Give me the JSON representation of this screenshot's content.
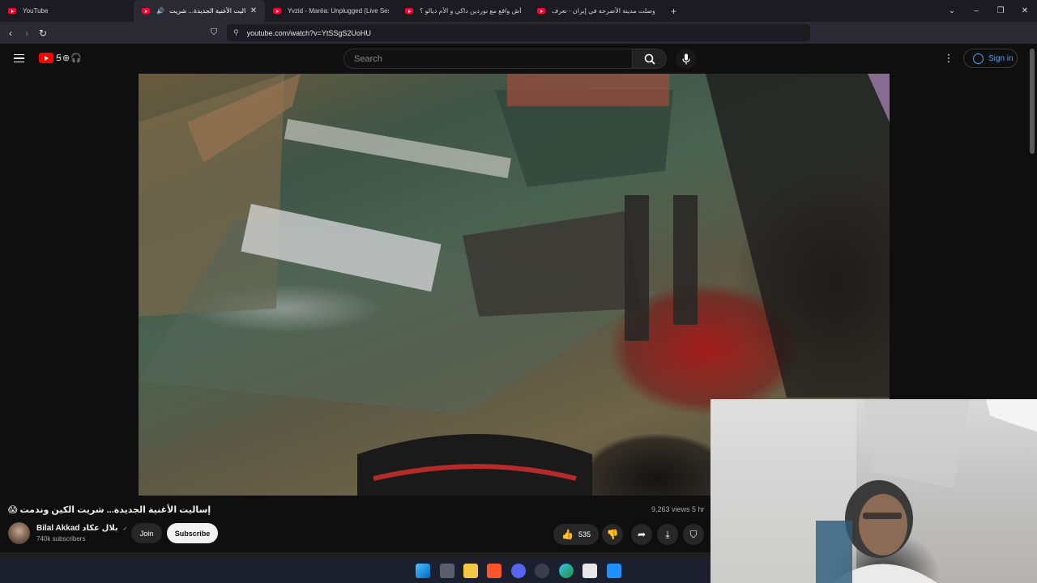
{
  "browser": {
    "tabs": [
      {
        "label": "YouTube"
      },
      {
        "label": "إساليت الأغنية الجديدة... شريت",
        "active": true
      },
      {
        "label": "Yvzid - Maréa: Unplugged (Live Sess"
      },
      {
        "label": "أش واقع مع نوردين داكي و الأم ديالو ؟"
      },
      {
        "label": "وصلت مدينة الأضرحة في إيران - تعرف..."
      }
    ],
    "new_tab": "+",
    "url": "youtube.com/watch?v=YtSSgS2UoHU",
    "window_controls": [
      "⌄",
      "–",
      "❐",
      "✕"
    ]
  },
  "youtube": {
    "search_placeholder": "Search",
    "sign_in": "Sign in",
    "video": {
      "title": "😱 إساليت الأغنية الجديدة... شريت الكين وندمت",
      "views": "9,263 views  5 hr",
      "channel": "Bilal Akkad بلال عكاد",
      "verified": "✓",
      "subscribers": "740k subscribers",
      "join": "Join",
      "subscribe": "Subscribe",
      "likes": "535"
    }
  }
}
